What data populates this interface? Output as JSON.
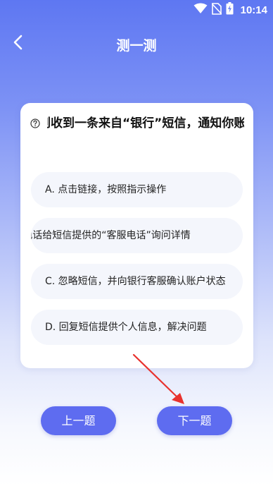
{
  "status_bar": {
    "time": "10:14",
    "icons": [
      "wifi-icon",
      "no-sim-icon",
      "battery-charging-icon"
    ]
  },
  "header": {
    "title": "测一测",
    "back_icon": "chevron-left-icon"
  },
  "question": {
    "help_icon": "question-circle-icon",
    "text": "到收到一条来自“银行”短信，通知你账"
  },
  "options": [
    {
      "label": "A. 点击链接，按照指示操作"
    },
    {
      "label": "A. 电话给短信提供的“客服电话”询问详情"
    },
    {
      "label": "C. 忽略短信，并向银行客服确认账户状态"
    },
    {
      "label": "D. 回复短信提供个人信息，解决问题"
    }
  ],
  "buttons": {
    "prev": "上一题",
    "next": "下一题"
  },
  "colors": {
    "accent": "#5e6cf0",
    "annotation_arrow": "#e8322e"
  }
}
